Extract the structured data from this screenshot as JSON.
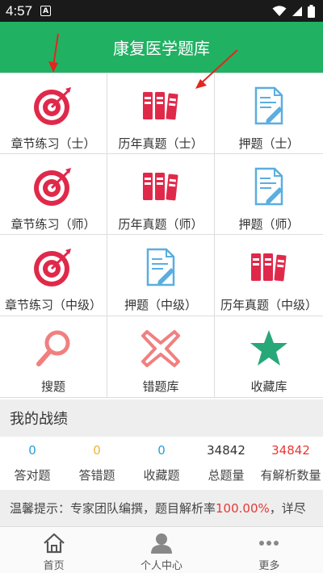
{
  "status": {
    "time": "4:57",
    "notif_glyph": "A"
  },
  "header": {
    "title": "康复医学题库"
  },
  "grid": [
    {
      "label": "章节练习（士）",
      "icon": "target-icon"
    },
    {
      "label": "历年真题（士）",
      "icon": "binders-icon"
    },
    {
      "label": "押题（士）",
      "icon": "document-pen-icon"
    },
    {
      "label": "章节练习（师）",
      "icon": "target-icon"
    },
    {
      "label": "历年真题（师）",
      "icon": "binders-icon"
    },
    {
      "label": "押题（师）",
      "icon": "document-pen-icon"
    },
    {
      "label": "章节练习（中级）",
      "icon": "target-icon"
    },
    {
      "label": "押题（中级）",
      "icon": "document-pen-icon"
    },
    {
      "label": "历年真题（中级）",
      "icon": "binders-icon"
    },
    {
      "label": "搜题",
      "icon": "search-icon"
    },
    {
      "label": "错题库",
      "icon": "cross-icon"
    },
    {
      "label": "收藏库",
      "icon": "star-icon"
    }
  ],
  "record": {
    "title": "我的战绩"
  },
  "stats": [
    {
      "value": "0",
      "label": "答对题",
      "color": "#2a9fd6"
    },
    {
      "value": "0",
      "label": "答错题",
      "color": "#f0b33a"
    },
    {
      "value": "0",
      "label": "收藏题",
      "color": "#2a9fd6"
    },
    {
      "value": "34842",
      "label": "总题量",
      "color": "#333333"
    },
    {
      "value": "34842",
      "label": "有解析数量",
      "color": "#e53935"
    }
  ],
  "tip": {
    "prefix": "温馨提示：专家团队编撰，题目解析率",
    "rate": "100.00%",
    "suffix": "，详尽"
  },
  "tabs": [
    {
      "label": "首页",
      "icon": "home-icon"
    },
    {
      "label": "个人中心",
      "icon": "user-icon"
    },
    {
      "label": "更多",
      "icon": "more-icon"
    }
  ],
  "colors": {
    "brand": "#21b163",
    "icon_red": "#e0294a",
    "icon_blue": "#5aaee0",
    "icon_pink": "#f08080",
    "star_green": "#28a878"
  }
}
